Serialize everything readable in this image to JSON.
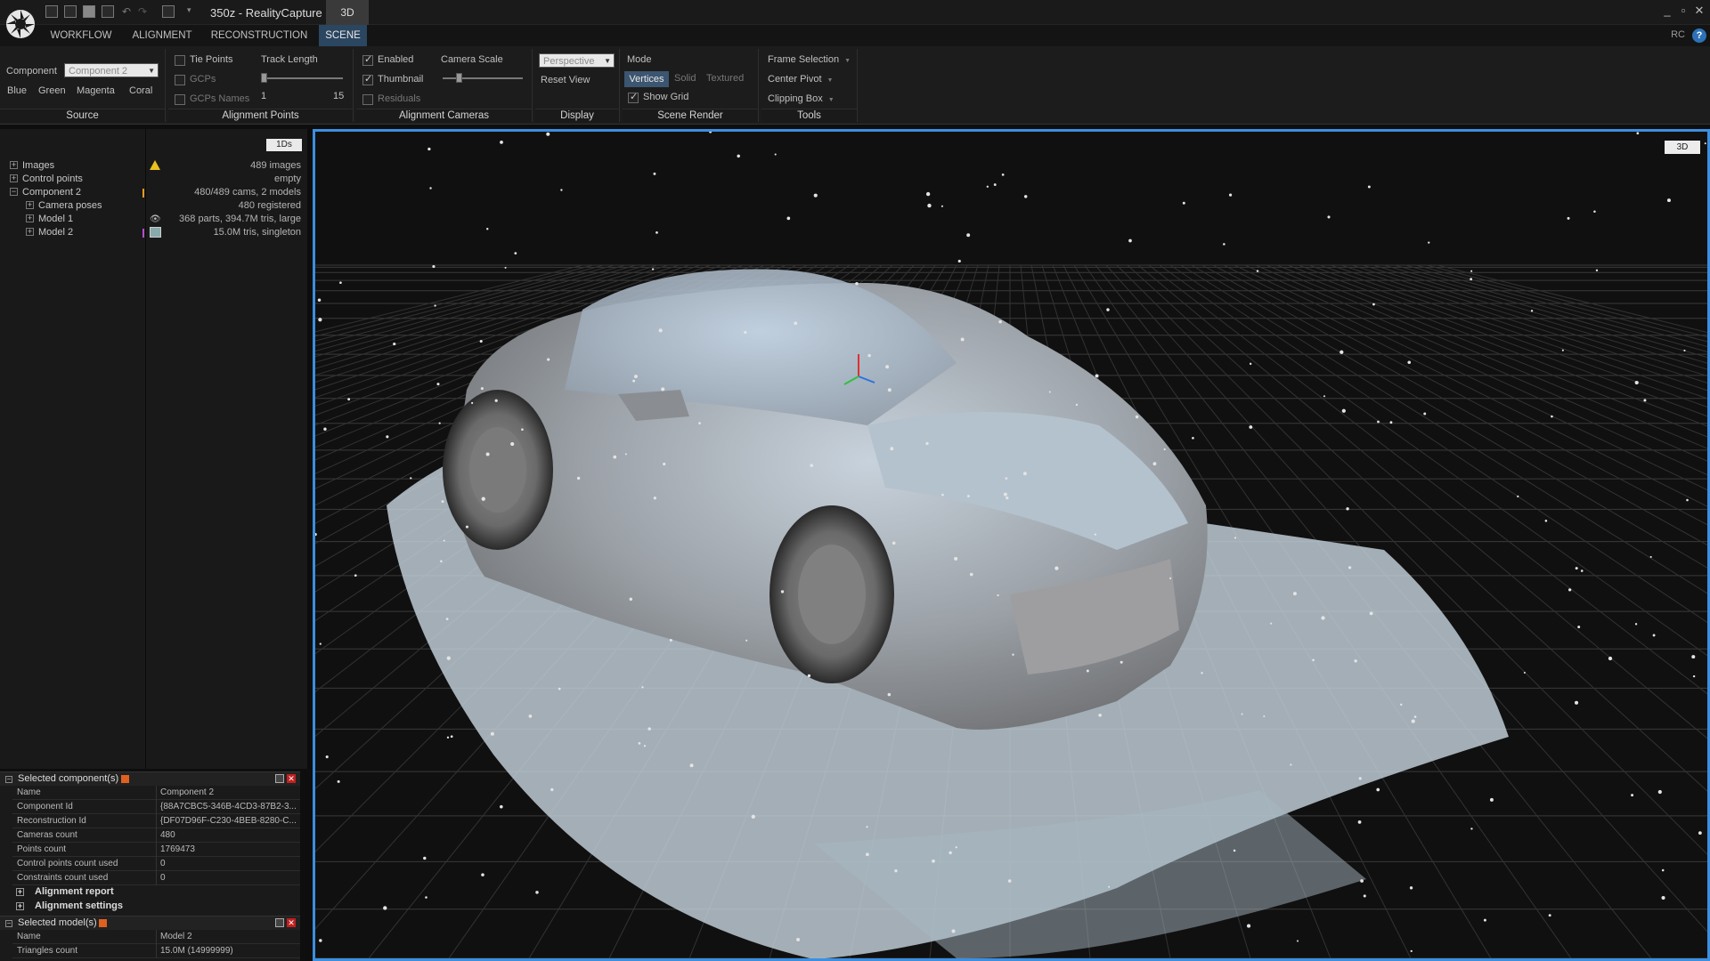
{
  "titlebar": {
    "title": "350z - RealityCapture",
    "view_tab": "3D"
  },
  "menu": {
    "tabs": [
      "WORKFLOW",
      "ALIGNMENT",
      "RECONSTRUCTION",
      "SCENE"
    ],
    "active": "SCENE",
    "corner": "RC",
    "help": "?"
  },
  "ribbon": {
    "source": {
      "component_label": "Component",
      "component_value": "Component 2",
      "colors": [
        "Blue",
        "Green",
        "Magenta",
        "Coral"
      ],
      "title": "Source"
    },
    "alignment_points": {
      "tie_points": "Tie Points",
      "gcps": "GCPs",
      "gcps_names": "GCPs Names",
      "track_length_label": "Track Length",
      "track_min": "1",
      "track_max": "15",
      "title": "Alignment Points"
    },
    "alignment_cameras": {
      "enabled": "Enabled",
      "thumbnail": "Thumbnail",
      "residuals": "Residuals",
      "camera_scale_label": "Camera Scale",
      "title": "Alignment Cameras"
    },
    "display": {
      "projection": "Perspective",
      "reset_view": "Reset View",
      "title": "Display"
    },
    "scene_render": {
      "mode_label": "Mode",
      "modes": [
        "Vertices",
        "Solid",
        "Textured"
      ],
      "active_mode": "Vertices",
      "show_grid": "Show Grid",
      "title": "Scene Render"
    },
    "tools": {
      "frame_selection": "Frame Selection",
      "center_pivot": "Center Pivot",
      "clipping_box": "Clipping Box",
      "title": "Tools"
    }
  },
  "tree": {
    "duration": "1Ds",
    "rows": [
      {
        "name": "Images",
        "value": "489 images"
      },
      {
        "name": "Control points",
        "value": "empty"
      },
      {
        "name": "Component 2",
        "value": "480/489 cams, 2 models"
      },
      {
        "name": "Camera poses",
        "value": "480 registered"
      },
      {
        "name": "Model 1",
        "value": "368 parts, 394.7M tris, large"
      },
      {
        "name": "Model 2",
        "value": "15.0M tris, singleton"
      }
    ]
  },
  "properties": {
    "selected_components": {
      "title": "Selected component(s)",
      "rows": [
        {
          "key": "Name",
          "value": "Component 2"
        },
        {
          "key": "Component Id",
          "value": "{88A7CBC5-346B-4CD3-87B2-3..."
        },
        {
          "key": "Reconstruction Id",
          "value": "{DF07D96F-C230-4BEB-8280-C..."
        },
        {
          "key": "Cameras count",
          "value": "480"
        },
        {
          "key": "Points count",
          "value": "1769473"
        },
        {
          "key": "Control points count used",
          "value": "0"
        },
        {
          "key": "Constraints count used",
          "value": "0"
        }
      ],
      "subsections": [
        "Alignment report",
        "Alignment settings"
      ]
    },
    "selected_models": {
      "title": "Selected model(s)",
      "rows": [
        {
          "key": "Name",
          "value": "Model 2"
        },
        {
          "key": "Triangles count",
          "value": "15.0M (14999999)"
        }
      ]
    }
  },
  "viewport": {
    "label": "3D"
  },
  "colors": {
    "accent": "#3b8fe0",
    "active_tab": "#2b4660",
    "warning": "#e8c020"
  },
  "icons": [
    "app-logo-icon",
    "warning-icon",
    "eye-icon",
    "camera-icon",
    "close-icon",
    "help-icon"
  ]
}
